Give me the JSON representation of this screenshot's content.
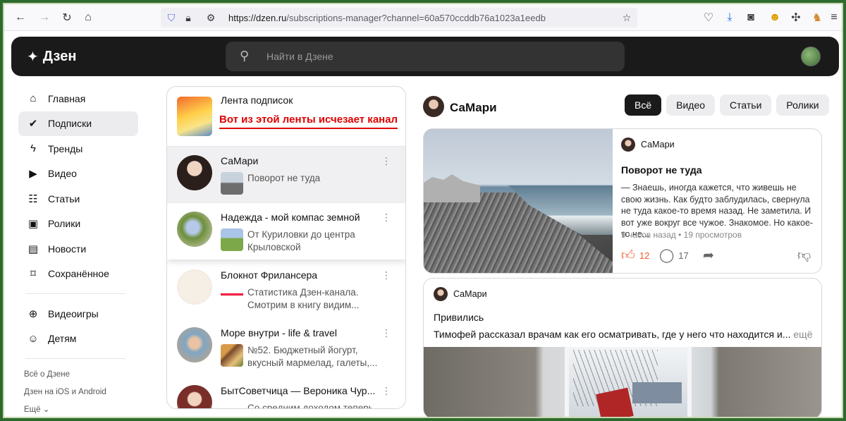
{
  "browser": {
    "url_host": "https://dzen.ru",
    "url_path": "/subscriptions-manager?channel=60a570ccddb76a1023a1eedb",
    "icons": [
      "back-icon",
      "forward-icon",
      "reload-icon",
      "home-icon",
      "shield-icon",
      "lock-icon",
      "permissions-icon",
      "star-icon",
      "pocket-icon",
      "download-icon",
      "extension-icon",
      "emoji-extension-icon",
      "puzzle-icon",
      "cat-extension-icon",
      "menu-icon"
    ]
  },
  "header": {
    "logo": "Дзен",
    "search_placeholder": "Найти в Дзене"
  },
  "sidebar": {
    "items": [
      {
        "label": "Главная",
        "icon": "house-icon",
        "glyph": "⌂"
      },
      {
        "label": "Подписки",
        "icon": "subscriptions-icon",
        "glyph": "✔",
        "active": true
      },
      {
        "label": "Тренды",
        "icon": "lightning-icon",
        "glyph": "ϟ"
      },
      {
        "label": "Видео",
        "icon": "play-icon",
        "glyph": "▶"
      },
      {
        "label": "Статьи",
        "icon": "book-icon",
        "glyph": "☷"
      },
      {
        "label": "Ролики",
        "icon": "clips-icon",
        "glyph": "▣"
      },
      {
        "label": "Новости",
        "icon": "news-icon",
        "glyph": "▤"
      },
      {
        "label": "Сохранённое",
        "icon": "bookmark-icon",
        "glyph": "⌑"
      }
    ],
    "items2": [
      {
        "label": "Видеоигры",
        "icon": "gamepad-icon",
        "glyph": "⊕"
      },
      {
        "label": "Детям",
        "icon": "bear-icon",
        "glyph": "☺"
      }
    ],
    "footer": [
      "Всё о Дзене",
      "Дзен на iOS и Android",
      "Ещё ⌄"
    ]
  },
  "subscriptions": {
    "feed_title": "Лента подписок",
    "annotation": "Вот из этой ленты исчезает канал",
    "rows": [
      {
        "name": "СаМари",
        "post": "Поворот не туда",
        "selected": true
      },
      {
        "name": "Надежда - мой компас земной",
        "post": "От Куриловки до центра Крыловской"
      },
      {
        "name": "Блокнот Фрилансера",
        "post": "Статистика Дзен-канала. Смотрим в книгу видим..."
      },
      {
        "name": "Море внутри - life & travel",
        "post": "№52. Бюджетный йогурт, вкусный мармелад, галеты,..."
      },
      {
        "name": "БытСоветчица — Вероника Чур...",
        "post": "Со средним доходом теперь"
      }
    ]
  },
  "channel": {
    "name": "СаМари",
    "filters": [
      {
        "label": "Всё",
        "active": true
      },
      {
        "label": "Видео"
      },
      {
        "label": "Статьи"
      },
      {
        "label": "Ролики"
      }
    ]
  },
  "post1": {
    "author": "СаМари",
    "title": "Поворот не туда",
    "text": "— Знаешь, иногда кажется, что живешь не свою жизнь. Как будто заблудилась, свернула не туда какое-то время назад. Не заметила. И вот уже вокруг все чужое. Знакомое. Но какое-то не...",
    "meta": "9 часов назад • 19 просмотров",
    "likes": "12",
    "comments": "17"
  },
  "post2": {
    "author": "СаМари",
    "title": "Привились",
    "text": "Тимофей рассказал врачам как его осматривать, где у него что находится и...",
    "more": "ещё"
  }
}
